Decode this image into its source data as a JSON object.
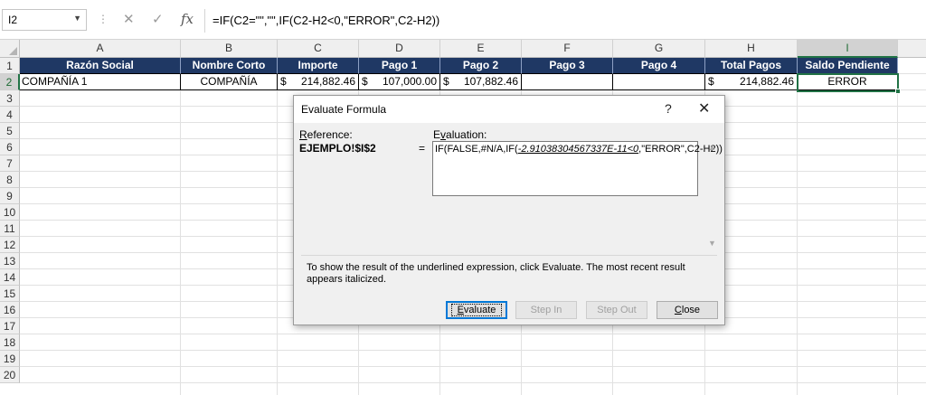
{
  "formula_bar": {
    "name_box": "I2",
    "name_box_arrow": "▼",
    "dots": "⋮",
    "cancel_icon": "✕",
    "enter_icon": "✓",
    "fx_label": "fx",
    "formula": "=IF(C2=\"\",\"\",IF(C2-H2<0,\"ERROR\",C2-H2))"
  },
  "columns": [
    "A",
    "B",
    "C",
    "D",
    "E",
    "F",
    "G",
    "H",
    "I"
  ],
  "selected_column": "I",
  "rows": [
    "1",
    "2",
    "3",
    "4",
    "5",
    "6",
    "7",
    "8",
    "9",
    "10",
    "11",
    "12",
    "13",
    "14",
    "15",
    "16",
    "17",
    "18",
    "19",
    "20"
  ],
  "selected_row": "2",
  "header_row": [
    "Razón Social",
    "Nombre Corto",
    "Importe",
    "Pago 1",
    "Pago 2",
    "Pago 3",
    "Pago 4",
    "Total Pagos",
    "Saldo Pendiente"
  ],
  "data_row": {
    "razon_social": "COMPAÑÍA 1",
    "nombre_corto": "COMPAÑÍA",
    "importe": {
      "sym": "$",
      "num": "214,882.46"
    },
    "pago1": {
      "sym": "$",
      "num": "107,000.00"
    },
    "pago2": {
      "sym": "$",
      "num": "107,882.46"
    },
    "pago3": "",
    "pago4": "",
    "total_pagos": {
      "sym": "$",
      "num": "214,882.46"
    },
    "saldo": "ERROR"
  },
  "dialog": {
    "title": "Evaluate Formula",
    "help_icon": "?",
    "close_icon": "✕",
    "reference_label_ul": "R",
    "reference_label_rest": "eference:",
    "reference_value": "EJEMPLO!$I$2",
    "equals": "=",
    "evaluation_label_ul": "v",
    "evaluation_label_pre": "E",
    "evaluation_label_rest": "aluation:",
    "evaluation_pre": "IF(FALSE,#N/A,IF(",
    "evaluation_underlined": "-2.91038304567337E-11<0",
    "evaluation_post": ",\"ERROR\",C2-H2))",
    "scroll_up": "▲",
    "scroll_down": "▼",
    "note": "To show the result of the underlined expression, click Evaluate.  The most recent result appears italicized.",
    "buttons": {
      "evaluate_ul": "E",
      "evaluate_rest": "valuate",
      "step_in": "Step In",
      "step_out": "Step Out",
      "close_ul": "C",
      "close_rest": "lose"
    }
  },
  "colors": {
    "header_fill": "#1f3864",
    "selection": "#217346"
  }
}
